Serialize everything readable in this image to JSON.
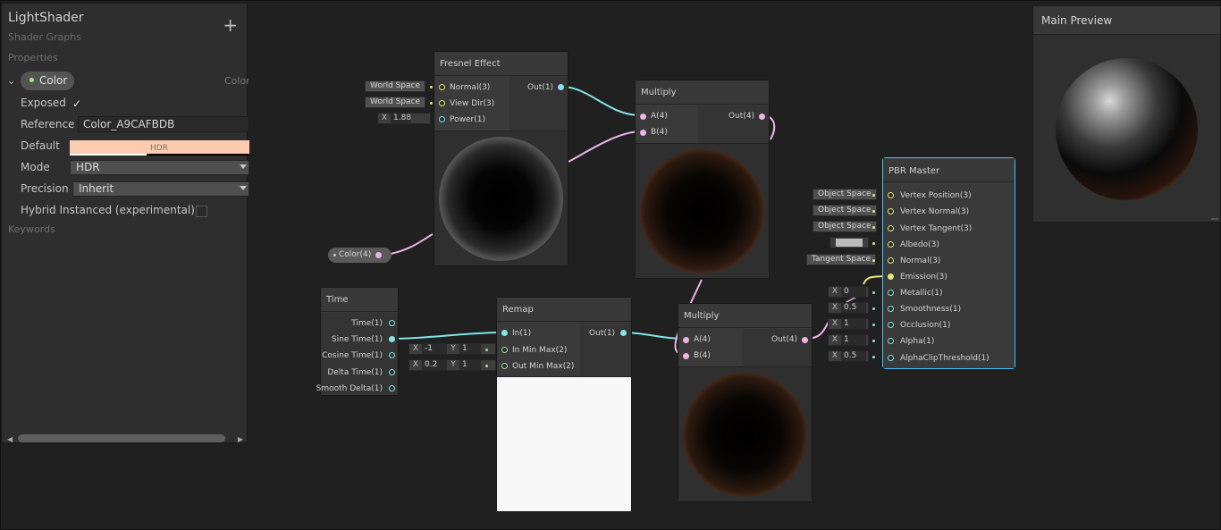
{
  "blackboard": {
    "title": "LightShader",
    "subtitle": "Shader Graphs",
    "add_icon": "+",
    "properties_label": "Properties",
    "property": {
      "name": "Color",
      "type": "Color",
      "exposed_label": "Exposed",
      "exposed_checked": "✓",
      "reference_label": "Reference",
      "reference_value": "Color_A9CAFBDB",
      "default_label": "Default",
      "default_hdr": "HDR",
      "default_color": "#ffcbb0",
      "mode_label": "Mode",
      "mode_value": "HDR",
      "precision_label": "Precision",
      "precision_value": "Inherit",
      "hybrid_label": "Hybrid Instanced (experimental)"
    },
    "keywords_label": "Keywords"
  },
  "nodes": {
    "fresnel": {
      "title": "Fresnel Effect",
      "inputs": [
        "Normal(3)",
        "View Dir(3)",
        "Power(1)"
      ],
      "output": "Out(1)",
      "input_tags": [
        "World Space",
        "World Space"
      ],
      "power_axis": "X",
      "power_value": "1.88"
    },
    "multiply1": {
      "title": "Multiply",
      "inputs": [
        "A(4)",
        "B(4)"
      ],
      "output": "Out(4)"
    },
    "color_prop": {
      "label": "Color(4)"
    },
    "time": {
      "title": "Time",
      "outputs": [
        "Time(1)",
        "Sine Time(1)",
        "Cosine Time(1)",
        "Delta Time(1)",
        "Smooth Delta(1)"
      ]
    },
    "remap": {
      "title": "Remap",
      "inputs": [
        "In(1)",
        "In Min Max(2)",
        "Out Min Max(2)"
      ],
      "output": "Out(1)",
      "in_min_max": {
        "x_label": "X",
        "x": "-1",
        "y_label": "Y",
        "y": "1"
      },
      "out_min_max": {
        "x_label": "X",
        "x": "0.2",
        "y_label": "Y",
        "y": "1"
      }
    },
    "multiply2": {
      "title": "Multiply",
      "inputs": [
        "A(4)",
        "B(4)"
      ],
      "output": "Out(4)"
    },
    "pbr": {
      "title": "PBR Master",
      "inputs": [
        "Vertex Position(3)",
        "Vertex Normal(3)",
        "Vertex Tangent(3)",
        "Albedo(3)",
        "Normal(3)",
        "Emission(3)",
        "Metallic(1)",
        "Smoothness(1)",
        "Occlusion(1)",
        "Alpha(1)",
        "AlphaClipThreshold(1)"
      ],
      "space_tags": [
        "Object Space",
        "Object Space",
        "Object Space",
        "",
        "Tangent Space"
      ],
      "values": [
        "0",
        "0.5",
        "1",
        "1",
        "0.5"
      ],
      "value_axis": "X"
    }
  },
  "main_preview": {
    "title": "Main Preview"
  },
  "colors": {
    "vector3": "#e8e57b",
    "vector1": "#84e4e7",
    "vector4": "#eeb3e8",
    "vector2": "#a4e594",
    "selected_outline": "#44c0ff"
  }
}
